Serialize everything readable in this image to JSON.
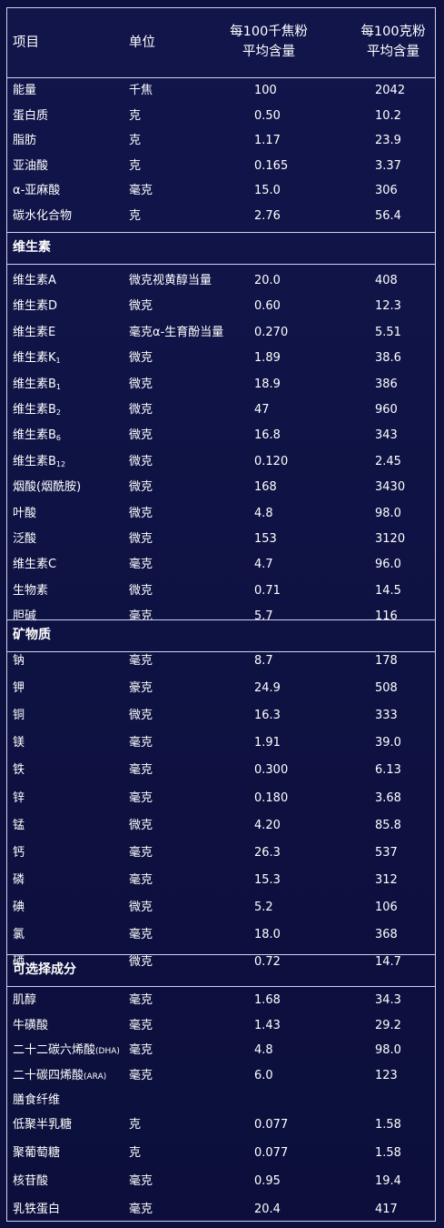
{
  "header": {
    "col_name": "项目",
    "col_unit": "单位",
    "col_per_kj_line1": "每100千焦粉",
    "col_per_kj_line2": "平均含量",
    "col_per_100g_line1": "每100克粉",
    "col_per_100g_line2": "平均含量"
  },
  "basic": [
    {
      "name": "能量",
      "unit": "千焦",
      "per_kj": "100",
      "per_100g": "2042"
    },
    {
      "name": "蛋白质",
      "unit": "克",
      "per_kj": "0.50",
      "per_100g": "10.2"
    },
    {
      "name": "脂肪",
      "unit": "克",
      "per_kj": "1.17",
      "per_100g": "23.9"
    },
    {
      "name": "亚油酸",
      "unit": "克",
      "per_kj": "0.165",
      "per_100g": "3.37"
    },
    {
      "name": "α-亚麻酸",
      "unit": "毫克",
      "per_kj": "15.0",
      "per_100g": "306"
    },
    {
      "name": "碳水化合物",
      "unit": "克",
      "per_kj": "2.76",
      "per_100g": "56.4"
    }
  ],
  "vitamins": {
    "title": "维生素",
    "rows": [
      {
        "name": "维生素A",
        "sub": "",
        "unit": "微克视黄醇当量",
        "per_kj": "20.0",
        "per_100g": "408"
      },
      {
        "name": "维生素D",
        "sub": "",
        "unit": "微克",
        "per_kj": "0.60",
        "per_100g": "12.3"
      },
      {
        "name": "维生素E",
        "sub": "",
        "unit": "毫克α-生育酚当量",
        "per_kj": "0.270",
        "per_100g": "5.51"
      },
      {
        "name": "维生素K",
        "sub": "1",
        "unit": "微克",
        "per_kj": "1.89",
        "per_100g": "38.6"
      },
      {
        "name": "维生素B",
        "sub": "1",
        "unit": "微克",
        "per_kj": "18.9",
        "per_100g": "386"
      },
      {
        "name": "维生素B",
        "sub": "2",
        "unit": "微克",
        "per_kj": "47",
        "per_100g": "960"
      },
      {
        "name": "维生素B",
        "sub": "6",
        "unit": "微克",
        "per_kj": "16.8",
        "per_100g": "343"
      },
      {
        "name": "维生素B",
        "sub": "12",
        "unit": "微克",
        "per_kj": "0.120",
        "per_100g": "2.45"
      },
      {
        "name": "烟酸(烟酰胺)",
        "sub": "",
        "unit": "微克",
        "per_kj": "168",
        "per_100g": "3430"
      },
      {
        "name": "叶酸",
        "sub": "",
        "unit": "微克",
        "per_kj": "4.8",
        "per_100g": "98.0"
      },
      {
        "name": "泛酸",
        "sub": "",
        "unit": "微克",
        "per_kj": "153",
        "per_100g": "3120"
      },
      {
        "name": "维生素C",
        "sub": "",
        "unit": "毫克",
        "per_kj": "4.7",
        "per_100g": "96.0"
      },
      {
        "name": "生物素",
        "sub": "",
        "unit": "微克",
        "per_kj": "0.71",
        "per_100g": "14.5"
      },
      {
        "name": "胆碱",
        "sub": "",
        "unit": "毫克",
        "per_kj": "5.7",
        "per_100g": "116"
      }
    ]
  },
  "minerals": {
    "title": "矿物质",
    "rows": [
      {
        "name": "钠",
        "unit": "毫克",
        "per_kj": "8.7",
        "per_100g": "178"
      },
      {
        "name": "钾",
        "unit": "豪克",
        "per_kj": "24.9",
        "per_100g": "508"
      },
      {
        "name": "铜",
        "unit": "微克",
        "per_kj": "16.3",
        "per_100g": "333"
      },
      {
        "name": "镁",
        "unit": "毫克",
        "per_kj": "1.91",
        "per_100g": "39.0"
      },
      {
        "name": "铁",
        "unit": "毫克",
        "per_kj": "0.300",
        "per_100g": "6.13"
      },
      {
        "name": "锌",
        "unit": "毫克",
        "per_kj": "0.180",
        "per_100g": "3.68"
      },
      {
        "name": "锰",
        "unit": "微克",
        "per_kj": "4.20",
        "per_100g": "85.8"
      },
      {
        "name": "钙",
        "unit": "毫克",
        "per_kj": "26.3",
        "per_100g": "537"
      },
      {
        "name": "磷",
        "unit": "毫克",
        "per_kj": "15.3",
        "per_100g": "312"
      },
      {
        "name": "碘",
        "unit": "微克",
        "per_kj": "5.2",
        "per_100g": "106"
      },
      {
        "name": "氯",
        "unit": "毫克",
        "per_kj": "18.0",
        "per_100g": "368"
      },
      {
        "name": "硒",
        "unit": "微克",
        "per_kj": "0.72",
        "per_100g": "14.7"
      }
    ]
  },
  "optional": {
    "title": "可选择成分",
    "rows": [
      {
        "name": "肌醇",
        "small": "",
        "unit": "毫克",
        "per_kj": "1.68",
        "per_100g": "34.3"
      },
      {
        "name": "牛磺酸",
        "small": "",
        "unit": "毫克",
        "per_kj": "1.43",
        "per_100g": "29.2"
      },
      {
        "name": "二十二碳六烯酸",
        "small": "(DHA)",
        "unit": "毫克",
        "per_kj": "4.8",
        "per_100g": "98.0"
      },
      {
        "name": "二十碳四烯酸",
        "small": "(ARA)",
        "unit": "毫克",
        "per_kj": "6.0",
        "per_100g": "123"
      }
    ],
    "fiber_title": "膳食纤维",
    "fiber_rows": [
      {
        "name": "低聚半乳糖",
        "unit": "克",
        "per_kj": "0.077",
        "per_100g": "1.58"
      },
      {
        "name": "聚葡萄糖",
        "unit": "克",
        "per_kj": "0.077",
        "per_100g": "1.58"
      },
      {
        "name": "核苷酸",
        "unit": "毫克",
        "per_kj": "0.95",
        "per_100g": "19.4"
      },
      {
        "name": "乳铁蛋白",
        "unit": "毫克",
        "per_kj": "20.4",
        "per_100g": "417"
      }
    ]
  }
}
